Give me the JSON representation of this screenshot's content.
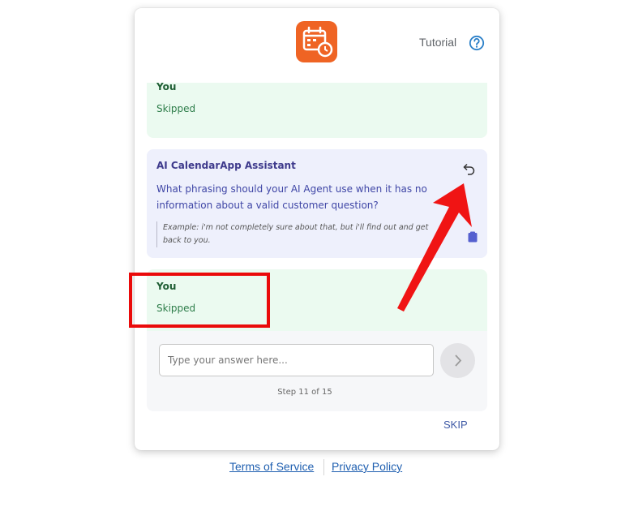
{
  "header": {
    "logo_icon": "calendar-clock-icon",
    "logo_color": "#ef6424",
    "tutorial_label": "Tutorial",
    "help_icon": "question-circle-icon"
  },
  "conversation": {
    "messages": [
      {
        "role": "user",
        "sender": "You",
        "text": "Skipped"
      },
      {
        "role": "assistant",
        "sender": "AI CalendarApp Assistant",
        "text": "What phrasing should your AI Agent use when it has no information about a valid customer question?",
        "example": "Example: i'm not completely sure about that, but i'll find out and get back to you.",
        "actions": [
          "undo-icon",
          "clipboard-icon"
        ]
      },
      {
        "role": "user",
        "sender": "You",
        "text": "Skipped"
      }
    ]
  },
  "composer": {
    "placeholder": "Type your answer here...",
    "value": "",
    "send_icon": "chevron-right-icon",
    "step_text": "Step 11 of 15"
  },
  "skip_label": "SKIP",
  "footer": {
    "terms_label": "Terms of Service",
    "privacy_label": "Privacy Policy"
  },
  "colors": {
    "user_bubble": "#ebfaf0",
    "assistant_bubble": "#eef0fc",
    "annotation_red": "#ea0a0a"
  }
}
